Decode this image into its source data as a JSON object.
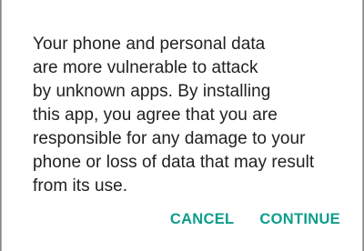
{
  "dialog": {
    "message_lines": [
      "Your phone and personal data",
      "are more vulnerable to attack",
      "by unknown apps. By installing",
      "this app, you agree that you are",
      "responsible for any damage to your",
      "phone or loss of data that may result",
      "from its use."
    ],
    "cancel_label": "CANCEL",
    "continue_label": "CONTINUE"
  },
  "colors": {
    "accent": "#0e9d8c",
    "text": "#212121",
    "background": "#ffffff"
  }
}
